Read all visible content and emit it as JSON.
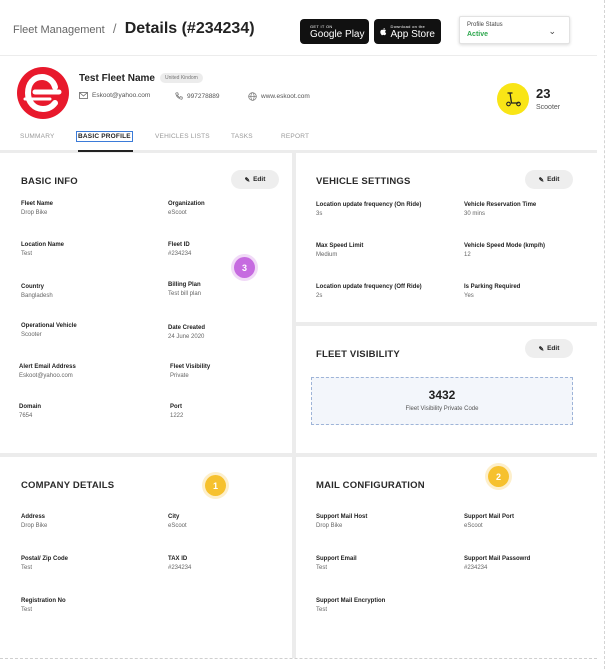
{
  "header": {
    "breadcrumb_root": "Fleet Management",
    "breadcrumb_sep": "/",
    "page_title": "Details (#234234)",
    "google_play_small": "GET IT ON",
    "google_play_big": "Google Play",
    "app_store_small": "Download on the",
    "app_store_big": "App Store",
    "profile_status_label": "Profile Status",
    "profile_status_value": "Active",
    "status_color": "#2fa84f"
  },
  "profile": {
    "name": "Test Fleet Name",
    "country_badge": "United Kindom",
    "email": "Eskoot@yahoo.com",
    "phone": "997278889",
    "website": "www.eskoot.com",
    "scooter_count": "23",
    "scooter_label": "Scooter",
    "logo_color": "#e8192c",
    "scooter_color": "#f9e516"
  },
  "tabs": [
    {
      "label": "SUMMARY"
    },
    {
      "label": "BASIC PROFILE"
    },
    {
      "label": "VEHICLES LISTS"
    },
    {
      "label": "TASKS"
    },
    {
      "label": "REPORT"
    }
  ],
  "basic_info": {
    "title": "BASIC INFO",
    "edit_label": "Edit",
    "badge": "3",
    "fields": [
      {
        "label": "Fleet Name",
        "value": "Drop Bike"
      },
      {
        "label": "Organization",
        "value": "eScoot"
      },
      {
        "label": "Location Name",
        "value": "Test"
      },
      {
        "label": "Fleet ID",
        "value": "#234234"
      },
      {
        "label": "Country",
        "value": "Bangladesh"
      },
      {
        "label": "Billing Plan",
        "value": "Test bill plan"
      },
      {
        "label": "Operational Vehicle",
        "value": "Scooter"
      },
      {
        "label": "Date Created",
        "value": "24 June 2020"
      },
      {
        "label": "Alert Email Address",
        "value": "Eskoot@yahoo.com"
      },
      {
        "label": "Fleet Visibility",
        "value": "Private"
      },
      {
        "label": "Domain",
        "value": "7654"
      },
      {
        "label": "Port",
        "value": "1222"
      }
    ]
  },
  "vehicle_settings": {
    "title": "VEHICLE SETTINGS",
    "edit_label": "Edit",
    "fields": [
      {
        "label": "Location update frequency (On Ride)",
        "value": "3s"
      },
      {
        "label": "Vehicle Reservation Time",
        "value": "30 mins"
      },
      {
        "label": "Max Speed Limit",
        "value": "Medium"
      },
      {
        "label": "Vehicle Speed Mode (kmp/h)",
        "value": "12"
      },
      {
        "label": "Location update frequency (Off Ride)",
        "value": "2s"
      },
      {
        "label": "Is Parking Required",
        "value": "Yes"
      }
    ]
  },
  "fleet_visibility": {
    "title": "FLEET VISIBILITY",
    "edit_label": "Edit",
    "code": "3432",
    "code_label": "Fleet Visibility Private Code"
  },
  "company_details": {
    "title": "COMPANY DETAILS",
    "badge": "1",
    "fields": [
      {
        "label": "Address",
        "value": "Drop Bike"
      },
      {
        "label": "City",
        "value": "eScoot"
      },
      {
        "label": "Postal/ Zip Code",
        "value": "Test"
      },
      {
        "label": "TAX ID",
        "value": "#234234"
      },
      {
        "label": "Registration No",
        "value": "Test"
      }
    ]
  },
  "mail_configuration": {
    "title": "MAIL CONFIGURATION",
    "badge": "2",
    "fields": [
      {
        "label": "Support Mail Host",
        "value": "Drop Bike"
      },
      {
        "label": "Support Mail Port",
        "value": "eScoot"
      },
      {
        "label": "Support Email",
        "value": "Test"
      },
      {
        "label": "Support Mail Passowrd",
        "value": "#234234"
      },
      {
        "label": "Support Mail Encryption",
        "value": "Test"
      }
    ]
  }
}
